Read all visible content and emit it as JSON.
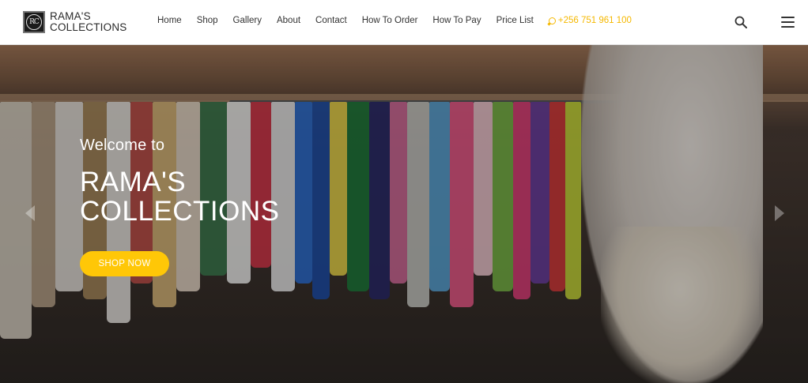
{
  "brand": {
    "line1": "RAMA'S",
    "line2": "COLLECTIONS",
    "mark": "RC"
  },
  "nav": {
    "items": [
      {
        "label": "Home"
      },
      {
        "label": "Shop"
      },
      {
        "label": "Gallery"
      },
      {
        "label": "About"
      },
      {
        "label": "Contact"
      },
      {
        "label": "How To Order"
      },
      {
        "label": "How To Pay"
      },
      {
        "label": "Price List"
      }
    ],
    "phone": "+256 751 961 100",
    "phone_icon": "whatsapp-icon"
  },
  "header_icons": {
    "search": "search-icon",
    "menu": "hamburger-menu-icon"
  },
  "hero": {
    "welcome": "Welcome to",
    "title_line1": "RAMA'S",
    "title_line2": "COLLECTIONS",
    "cta": "SHOP NOW",
    "prev_icon": "chevron-left-icon",
    "next_icon": "chevron-right-icon"
  },
  "colors": {
    "accent": "#ffc707",
    "phone": "#f5b800",
    "text": "#333333"
  }
}
